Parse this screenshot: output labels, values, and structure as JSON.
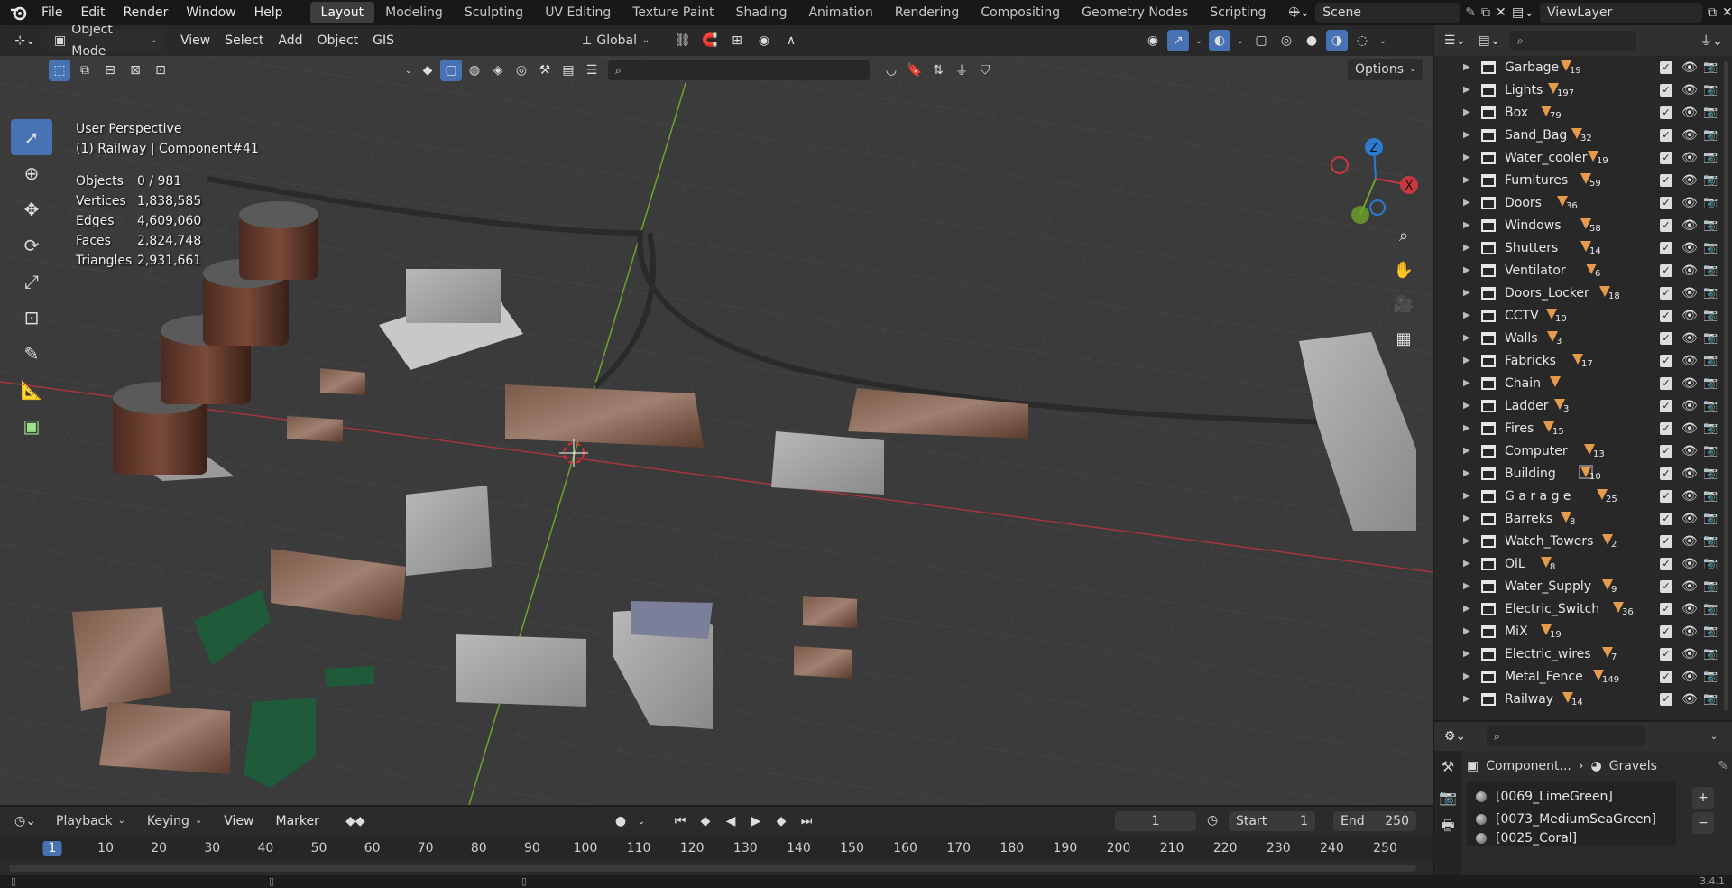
{
  "topbar": {
    "menus": [
      "File",
      "Edit",
      "Render",
      "Window",
      "Help"
    ],
    "workspaces": [
      "Layout",
      "Modeling",
      "Sculpting",
      "UV Editing",
      "Texture Paint",
      "Shading",
      "Animation",
      "Rendering",
      "Compositing",
      "Geometry Nodes",
      "Scripting"
    ],
    "active_workspace": "Layout",
    "add_workspace": "+",
    "scene": "Scene",
    "view_layer": "ViewLayer"
  },
  "viewport": {
    "mode": "Object Mode",
    "menus": [
      "View",
      "Select",
      "Add",
      "Object",
      "GIS"
    ],
    "orientation": "Global",
    "options_label": "Options",
    "overlay_title": "User Perspective",
    "overlay_subtitle": "(1) Railway | Component#41",
    "stats": [
      {
        "label": "Objects",
        "value": "0 / 981"
      },
      {
        "label": "Vertices",
        "value": "1,838,585"
      },
      {
        "label": "Edges",
        "value": "4,609,060"
      },
      {
        "label": "Faces",
        "value": "2,824,748"
      },
      {
        "label": "Triangles",
        "value": "2,931,661"
      }
    ],
    "gizmo": {
      "z": "Z",
      "x": "X",
      "y": "Y"
    }
  },
  "outliner": {
    "search_placeholder": "",
    "collections": [
      {
        "name": "Garbage",
        "count": "19"
      },
      {
        "name": "Lights",
        "count": "197"
      },
      {
        "name": "Box",
        "count": "79"
      },
      {
        "name": "Sand_Bag",
        "count": "32"
      },
      {
        "name": "Water_cooler",
        "count": "19"
      },
      {
        "name": "Furnitures",
        "count": "59"
      },
      {
        "name": "Doors",
        "count": "36"
      },
      {
        "name": "Windows",
        "count": "58"
      },
      {
        "name": "Shutters",
        "count": "14"
      },
      {
        "name": "Ventilator",
        "count": "6"
      },
      {
        "name": "Doors_Locker",
        "count": "18"
      },
      {
        "name": "CCTV",
        "count": "10"
      },
      {
        "name": "Walls",
        "count": "3"
      },
      {
        "name": "Fabricks",
        "count": "17"
      },
      {
        "name": "Chain",
        "count": ""
      },
      {
        "name": "Ladder",
        "count": "3"
      },
      {
        "name": "Fires",
        "count": "15"
      },
      {
        "name": "Computer",
        "count": "13"
      },
      {
        "name": "Building",
        "count": "10"
      },
      {
        "name": "G a r a g e",
        "count": "25"
      },
      {
        "name": "Barreks",
        "count": "8"
      },
      {
        "name": "Watch_Towers",
        "count": "2"
      },
      {
        "name": "OiL",
        "count": "8"
      },
      {
        "name": "Water_Supply",
        "count": "9"
      },
      {
        "name": "Electric_Switch",
        "count": "36"
      },
      {
        "name": "MiX",
        "count": "19"
      },
      {
        "name": "Electric_wires",
        "count": "7"
      },
      {
        "name": "Metal_Fence",
        "count": "149"
      },
      {
        "name": "Railway",
        "count": "14"
      }
    ]
  },
  "properties": {
    "breadcrumb_object": "Component...",
    "breadcrumb_material": "Gravels",
    "materials": [
      "[0069_LimeGreen]",
      "[0073_MediumSeaGreen]",
      "[0025_Coral]"
    ]
  },
  "timeline": {
    "menus": [
      "Playback",
      "Keying",
      "View",
      "Marker"
    ],
    "current_frame": "1",
    "start_label": "Start",
    "start": "1",
    "end_label": "End",
    "end": "250",
    "ticks": [
      "1",
      "10",
      "20",
      "30",
      "40",
      "50",
      "60",
      "70",
      "80",
      "90",
      "100",
      "110",
      "120",
      "130",
      "140",
      "150",
      "160",
      "170",
      "180",
      "190",
      "200",
      "210",
      "220",
      "230",
      "240",
      "250"
    ]
  },
  "status": {
    "version": "3.4.1"
  },
  "colors": {
    "accent": "#4772b3",
    "collection_icon": "#e59a4c",
    "x_axis": "#c0313f",
    "y_axis": "#7bb52a"
  }
}
